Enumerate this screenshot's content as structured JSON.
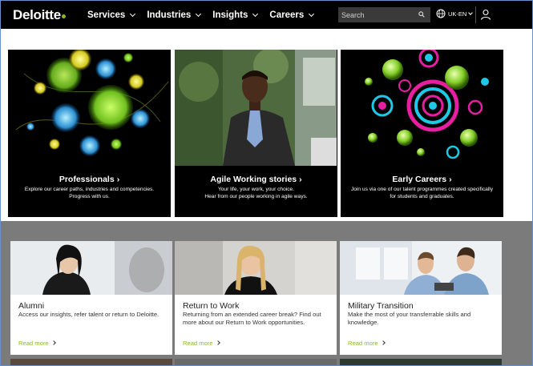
{
  "header": {
    "logo_text": "Deloitte",
    "logo_dot_color": "#86bc25",
    "nav": [
      {
        "label": "Services"
      },
      {
        "label": "Industries"
      },
      {
        "label": "Insights"
      },
      {
        "label": "Careers"
      }
    ],
    "search_placeholder": "Search",
    "language": "UK-EN"
  },
  "top_cards": [
    {
      "title": "Professionals",
      "desc_line1": "Explore our career paths, industries and competencies.",
      "desc_line2": "Progress with us.",
      "arrow": "›"
    },
    {
      "title": "Agile Working stories",
      "desc_line1": "Your life, your work, your choice.",
      "desc_line2": "Hear from our people working in agile ways.",
      "arrow": "›"
    },
    {
      "title": "Early Careers",
      "desc_line1": "Join us via one of our talent programmes created specifically",
      "desc_line2": "for students and graduates.",
      "arrow": "›"
    }
  ],
  "cards": [
    {
      "title": "Alumni",
      "desc": "Access our insights, refer talent or return to Deloitte.",
      "link": "Read more"
    },
    {
      "title": "Return to Work",
      "desc": "Returning from an extended career break? Find out more about our Return to Work opportunities.",
      "link": "Read more"
    },
    {
      "title": "Military Transition",
      "desc": "Make the most of your transferrable skills and knowledge.",
      "link": "Read more"
    }
  ],
  "colors": {
    "accent_green": "#86bc25",
    "header_bg": "#000000",
    "section_grey": "#7b7b7b"
  }
}
